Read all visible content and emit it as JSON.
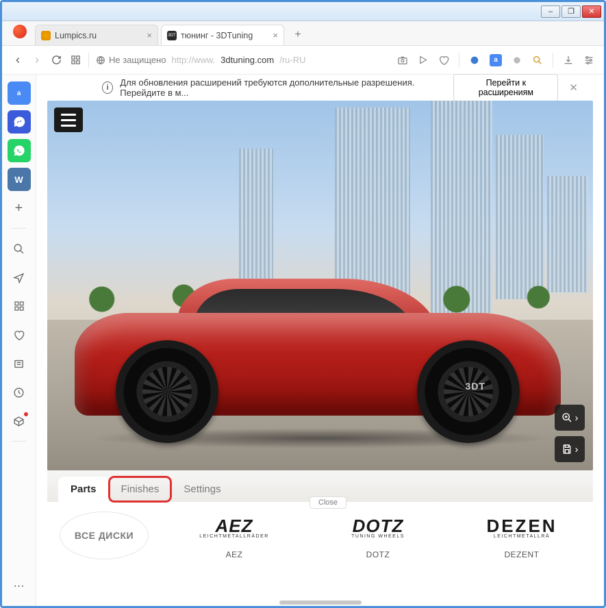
{
  "window": {
    "controls": {
      "minimize": "–",
      "maximize": "❐",
      "close": "✕"
    }
  },
  "tabs": [
    {
      "title": "Lumpics.ru",
      "favicon_color": "#f0a500",
      "active": false
    },
    {
      "title": "тюнинг - 3DTuning",
      "favicon_label": "3DT",
      "active": true
    }
  ],
  "address": {
    "security_label": "Не защищено",
    "url_prefix": "http://www.",
    "url_host": "3dtuning.com",
    "url_path": "/ru-RU"
  },
  "notification": {
    "text": "Для обновления расширений требуются дополнительные разрешения. Перейдите в м...",
    "button": "Перейти к расширениям"
  },
  "sidebar": {
    "items": [
      {
        "name": "translate",
        "label": "a"
      },
      {
        "name": "messenger",
        "glyph": "✉"
      },
      {
        "name": "whatsapp",
        "glyph": "✆"
      },
      {
        "name": "vk",
        "label": "W"
      },
      {
        "name": "add",
        "glyph": "+"
      },
      {
        "name": "search",
        "glyph": "⌕"
      },
      {
        "name": "send",
        "glyph": "➤"
      },
      {
        "name": "speed-dial",
        "glyph": "⊞"
      },
      {
        "name": "heart",
        "glyph": "♡"
      },
      {
        "name": "news",
        "glyph": "▭"
      },
      {
        "name": "history",
        "glyph": "◷"
      },
      {
        "name": "box",
        "glyph": "⬡"
      },
      {
        "name": "more",
        "glyph": "⋯"
      }
    ]
  },
  "viewer": {
    "car_badge": "3DT",
    "zoom_glyph": "⊕",
    "next_glyph": "›",
    "save_glyph": "💾"
  },
  "parts": {
    "tabs": [
      {
        "label": "Parts",
        "active": true
      },
      {
        "label": "Finishes",
        "highlight": true
      },
      {
        "label": "Settings"
      }
    ],
    "close_label": "Close",
    "all_label": "ВСЕ ДИСКИ",
    "brands": [
      {
        "logo_big": "AEZ",
        "logo_sub": "LEICHTMETALLRÄDER",
        "name": "AEZ"
      },
      {
        "logo_big": "DOTZ",
        "logo_sub": "TUNING WHEELS",
        "name": "DOTZ"
      },
      {
        "logo_big": "DEZEN",
        "logo_sub": "LEICHTMETALLRÄ",
        "name": "DEZENT"
      }
    ]
  }
}
